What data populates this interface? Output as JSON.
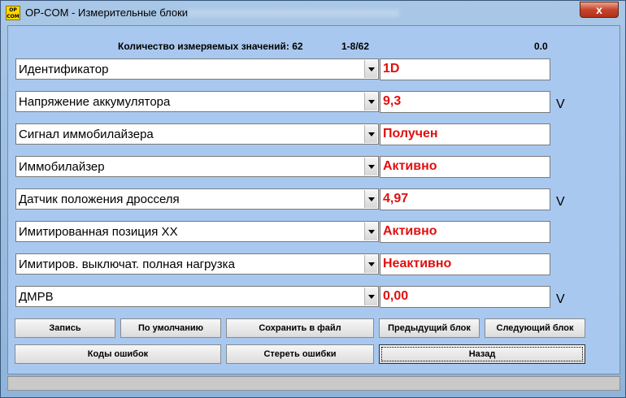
{
  "window": {
    "title": "OP-COM - Измерительные блоки",
    "icon_text_top": "OP",
    "icon_text_bottom": "COM",
    "close_label": "x"
  },
  "header": {
    "count_label": "Количество измеряемых значений: 62",
    "range": "1-8/62",
    "value": "0.0"
  },
  "rows": [
    {
      "label": "Идентификатор",
      "value": "1D",
      "unit": ""
    },
    {
      "label": "Напряжение аккумулятора",
      "value": "9,3",
      "unit": "V"
    },
    {
      "label": "Сигнал иммобилайзера",
      "value": "Получен",
      "unit": ""
    },
    {
      "label": "Иммобилайзер",
      "value": "Активно",
      "unit": ""
    },
    {
      "label": "Датчик положения дросселя",
      "value": "4,97",
      "unit": "V"
    },
    {
      "label": "Имитированная позиция  XX",
      "value": "Активно",
      "unit": ""
    },
    {
      "label": "Имитиров. выключат. полная нагрузка",
      "value": "Неактивно",
      "unit": ""
    },
    {
      "label": "ДМРВ",
      "value": "0,00",
      "unit": "V"
    }
  ],
  "buttons": {
    "record": "Запись",
    "default": "По умолчанию",
    "save_file": "Сохранить в файл",
    "prev_block": "Предыдущий блок",
    "next_block": "Следующий блок",
    "error_codes": "Коды ошибок",
    "clear_errors": "Стереть ошибки",
    "back": "Назад"
  },
  "colors": {
    "value_text": "#e01010",
    "client_bg": "#a9c8ef"
  }
}
